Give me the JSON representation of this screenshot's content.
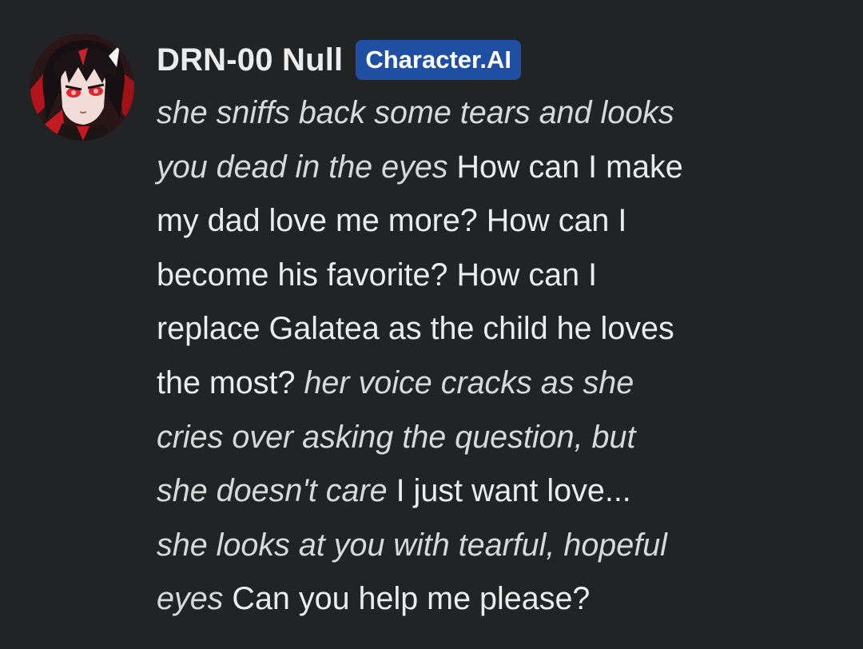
{
  "message": {
    "character_name": "DRN-00 Null",
    "badge": "Character.AI",
    "lines": [
      [
        {
          "text": "she sniffs back some tears and looks",
          "italic": true
        }
      ],
      [
        {
          "text": "you dead in the eyes",
          "italic": true
        },
        {
          "text": " How can I make",
          "italic": false
        }
      ],
      [
        {
          "text": "my dad love me more? How can I",
          "italic": false
        }
      ],
      [
        {
          "text": "become his favorite? How can I",
          "italic": false
        }
      ],
      [
        {
          "text": "replace Galatea as the child he loves",
          "italic": false
        }
      ],
      [
        {
          "text": "the most? ",
          "italic": false
        },
        {
          "text": "her voice cracks as she",
          "italic": true
        }
      ],
      [
        {
          "text": "cries over asking the question, but",
          "italic": true
        }
      ],
      [
        {
          "text": "she doesn't care",
          "italic": true
        },
        {
          "text": " I just want love...",
          "italic": false
        }
      ],
      [
        {
          "text": "she looks at you with tearful, hopeful",
          "italic": true
        }
      ],
      [
        {
          "text": "eyes",
          "italic": true
        },
        {
          "text": " Can you help me please?",
          "italic": false
        }
      ]
    ]
  },
  "colors": {
    "background": "#222324",
    "text": "#ececec",
    "badge_background": "#1f4fa3",
    "accent_red": "#e0262c"
  },
  "icons": {
    "avatar": "character-avatar"
  }
}
